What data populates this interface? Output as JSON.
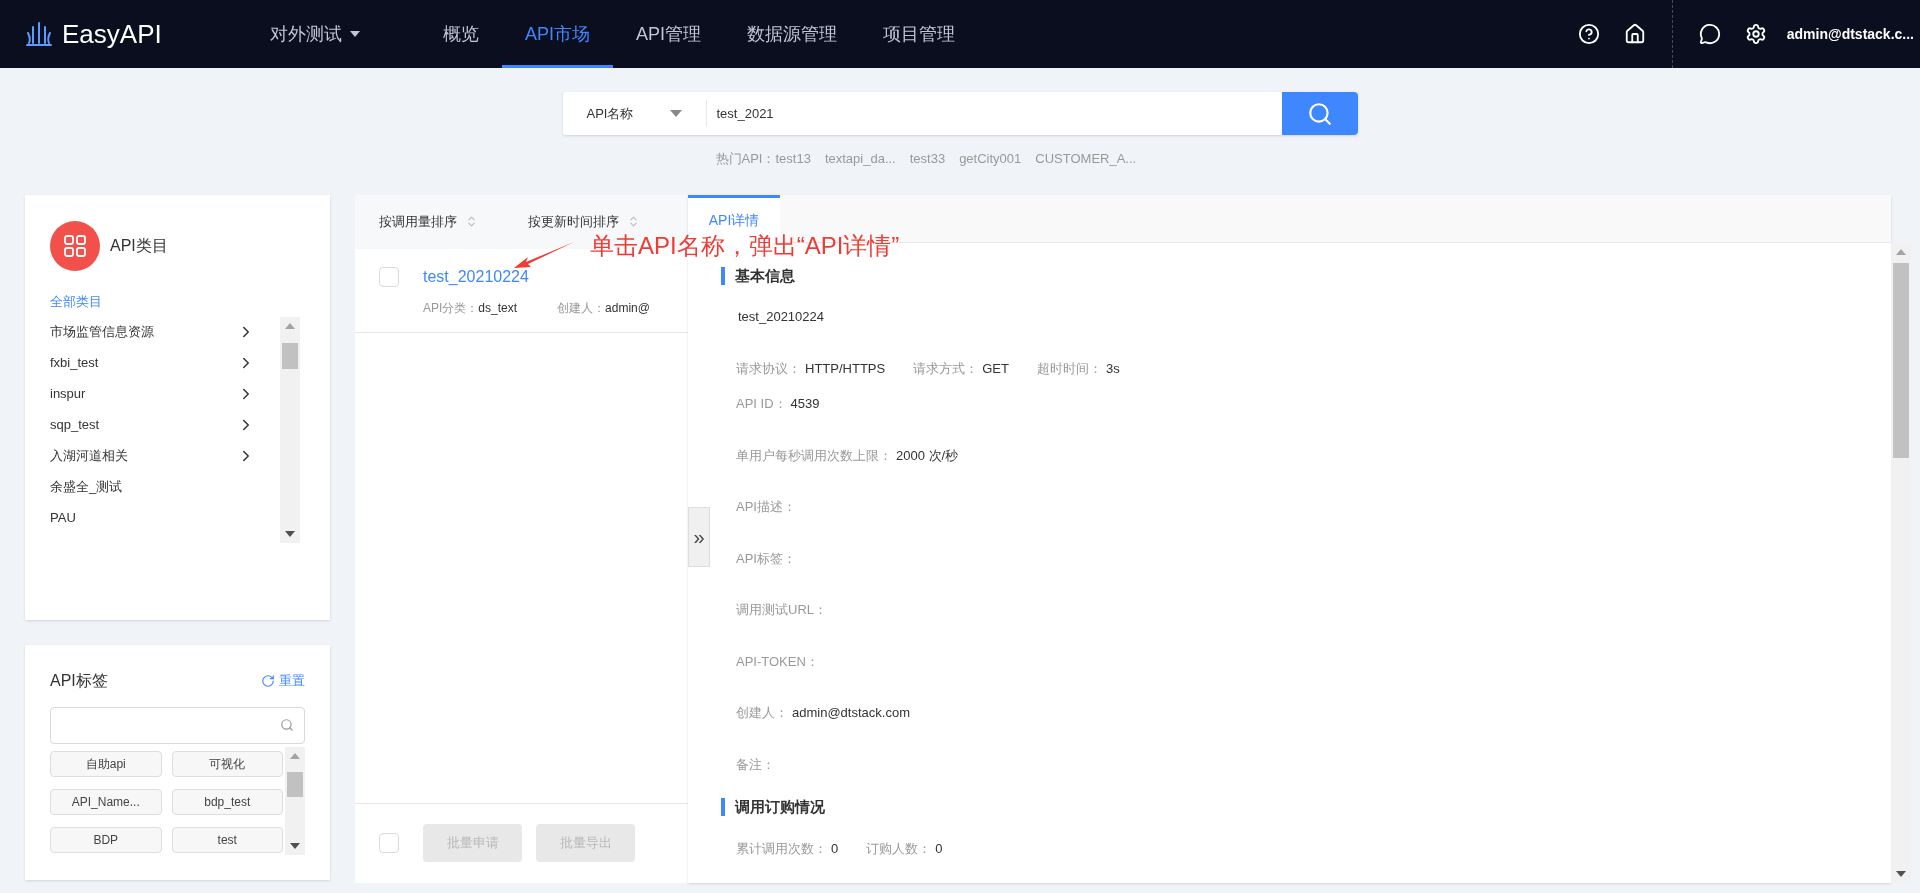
{
  "header": {
    "logo": "EasyAPI",
    "project": "对外测试",
    "nav": [
      {
        "label": "概览",
        "selected": false
      },
      {
        "label": "API市场",
        "selected": true
      },
      {
        "label": "API管理",
        "selected": false
      },
      {
        "label": "数据源管理",
        "selected": false
      },
      {
        "label": "项目管理",
        "selected": false
      }
    ],
    "user": "admin@dtstack.c..."
  },
  "search": {
    "field": "API名称",
    "value": "test_2021",
    "hot_label": "热门API：",
    "hot_items": [
      "test13",
      "textapi_da...",
      "test33",
      "getCity001",
      "CUSTOMER_A..."
    ]
  },
  "category_panel": {
    "title": "API类目",
    "items": [
      {
        "label": "全部类目",
        "selected": true,
        "has_children": false
      },
      {
        "label": "市场监管信息资源",
        "selected": false,
        "has_children": true
      },
      {
        "label": "fxbi_test",
        "selected": false,
        "has_children": true
      },
      {
        "label": "inspur",
        "selected": false,
        "has_children": true
      },
      {
        "label": "sqp_test",
        "selected": false,
        "has_children": true
      },
      {
        "label": "入湖河道相关",
        "selected": false,
        "has_children": true
      },
      {
        "label": "余盛全_测试",
        "selected": false,
        "has_children": false
      },
      {
        "label": "PAU",
        "selected": false,
        "has_children": false
      }
    ]
  },
  "tag_panel": {
    "title": "API标签",
    "reset": "重置",
    "tags": [
      "自助api",
      "可视化",
      "API_Name...",
      "bdp_test",
      "BDP",
      "test"
    ]
  },
  "list": {
    "sort_options": [
      "按调用量排序",
      "按更新时间排序"
    ],
    "items": [
      {
        "name": "test_20210224",
        "checked": false,
        "category_label": "API分类：",
        "category": "ds_text",
        "creator_label": "创建人：",
        "creator": "admin@"
      }
    ],
    "select_all": {
      "checked": false
    },
    "buttons": [
      {
        "label": "批量申请",
        "disabled": true
      },
      {
        "label": "批量导出",
        "disabled": true
      }
    ]
  },
  "detail": {
    "tabs": [
      {
        "label": "API详情",
        "selected": true
      }
    ],
    "collapse": "»",
    "sections": [
      {
        "title": "基本信息",
        "name": "test_20210224",
        "rows": [
          [
            {
              "label": "请求协议：",
              "value": "HTTP/HTTPS"
            },
            {
              "label": "请求方式：",
              "value": "GET"
            },
            {
              "label": "超时时间：",
              "value": "3s"
            }
          ],
          [
            {
              "label": "API ID：",
              "value": "4539"
            }
          ],
          [
            {
              "label": "单用户每秒调用次数上限：",
              "value": "2000 次/秒"
            }
          ],
          [
            {
              "label": "API描述："
            }
          ],
          [
            {
              "label": "API标签："
            }
          ],
          [
            {
              "label": "调用测试URL："
            }
          ],
          [
            {
              "label": "API-TOKEN："
            }
          ],
          [
            {
              "label": "创建人：",
              "value": "admin@dtstack.com"
            }
          ],
          [
            {
              "label": "备注："
            }
          ]
        ]
      },
      {
        "title": "调用订购情况",
        "rows": [
          [
            {
              "label": "累计调用次数：",
              "value": "0"
            },
            {
              "label": "订购人数：",
              "value": "0"
            }
          ]
        ]
      }
    ]
  },
  "annotation": {
    "text": "单击API名称，弹出“API详情”"
  }
}
